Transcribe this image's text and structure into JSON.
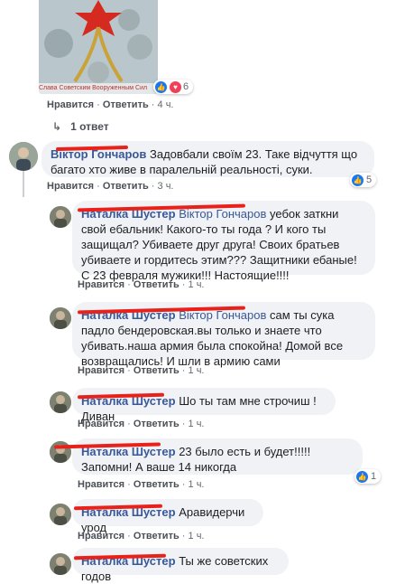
{
  "post_image": {
    "caption": "Слава Советским Вооруженным Сил"
  },
  "top_comment_actions": {
    "like": "Нравится",
    "reply": "Ответить",
    "time": "4 ч."
  },
  "top_reactions": {
    "count": "6"
  },
  "replies_toggle": {
    "label": "1 ответ"
  },
  "comments": [
    {
      "author": "Віктор Гончаров",
      "text": "Задовбали своїм 23. Таке відчуття що багато хто живе в паралельній реальності, суки.",
      "like": "Нравится",
      "reply": "Ответить",
      "time": "3 ч.",
      "reactions": "5"
    },
    {
      "author": "Наталка Шустер",
      "mention": "Віктор Гончаров",
      "text_line1": " уебок заткни свой",
      "text_rest": "ебальник! Какого-то ты года ? И кого ты защищал? Убиваете друг друга! Своих братьев убиваете и гордитесь этим??? Защитники ебаные! С 23 февраля мужики!!! Настоящие!!!!",
      "like": "Нравится",
      "reply": "Ответить",
      "time": "1 ч."
    },
    {
      "author": "Наталка Шустер",
      "mention": "Віктор Гончаров",
      "text_line1": " сам ты сука падло",
      "text_rest": "бендеровская.вы только и знаете что убивать.наша армия была спокойна! Домой все возвращались! И шли в армию сами",
      "like": "Нравится",
      "reply": "Ответить",
      "time": "1 ч."
    },
    {
      "author": "Наталка Шустер",
      "text": "Шо ты там мне строчиш ! Диван",
      "like": "Нравится",
      "reply": "Ответить",
      "time": "1 ч."
    },
    {
      "author": "Наталка Шустер",
      "text": "23 было есть и будет!!!!! Запомни! А ваше 14 никогда",
      "like": "Нравится",
      "reply": "Ответить",
      "time": "1 ч.",
      "reactions": "1"
    },
    {
      "author": "Наталка Шустер",
      "text": "Аравидерчи урод",
      "like": "Нравится",
      "reply": "Ответить",
      "time": "1 ч."
    },
    {
      "author": "Наталка Шустер",
      "text": "Ты же советских годов",
      "like": "Нравится",
      "reply": "Ответить",
      "time": "1 ч."
    }
  ],
  "colors": {
    "bubble": "#f0f2f5",
    "author": "#385898",
    "redaction": "#e8221a",
    "meta": "#65676b",
    "like": "#1877f2"
  }
}
